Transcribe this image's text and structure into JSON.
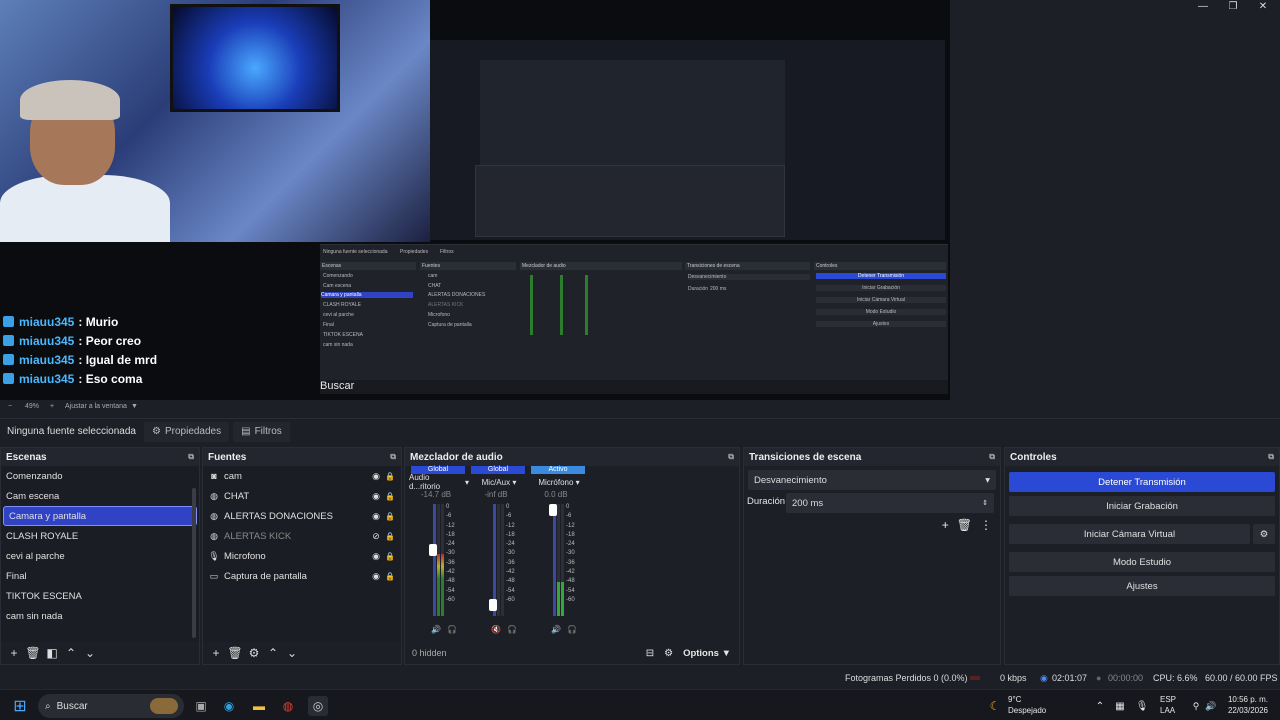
{
  "window": {
    "min": "—",
    "max": "❐",
    "close": "✕"
  },
  "chat": [
    {
      "user": "miauu345",
      "message": ": Murio"
    },
    {
      "user": "miauu345",
      "message": ": Peor creo"
    },
    {
      "user": "miauu345",
      "message": ": Igual de mrd"
    },
    {
      "user": "miauu345",
      "message": ": Eso coma"
    }
  ],
  "zoombar": {
    "minus": "−",
    "zoom": "49%",
    "plus": "+",
    "fit": "Ajustar a la ventana",
    "caret": "▼"
  },
  "context": {
    "no_source": "Ninguna fuente seleccionada",
    "properties": "Propiedades",
    "filters": "Filtros"
  },
  "scenes": {
    "title": "Escenas",
    "items": [
      "Comenzando",
      "Cam escena",
      "Camara y pantalla",
      "CLASH ROYALE",
      "cevi al parche",
      "Final",
      "TIKTOK ESCENA",
      "cam sin nada"
    ],
    "selected_index": 2
  },
  "sources": {
    "title": "Fuentes",
    "items": [
      {
        "name": "cam",
        "icon": "camera-icon"
      },
      {
        "name": "CHAT",
        "icon": "globe-icon"
      },
      {
        "name": "ALERTAS DONACIONES",
        "icon": "globe-icon"
      },
      {
        "name": "ALERTAS KICK",
        "icon": "globe-icon",
        "hidden": true
      },
      {
        "name": "Microfono",
        "icon": "mic-icon"
      },
      {
        "name": "Captura de pantalla",
        "icon": "monitor-icon"
      }
    ]
  },
  "mixer": {
    "title": "Mezclador de audio",
    "channels": [
      {
        "tag": "Global",
        "name": "Audio d...ritorio",
        "db": "-14.7 dB",
        "level": 0.55,
        "fader": 0.6
      },
      {
        "tag": "Global",
        "name": "Mic/Aux",
        "db": "-inf dB",
        "level": 0.0,
        "fader": 0.05,
        "muted": true
      },
      {
        "tag": "Activo",
        "name": "Micrófono",
        "db": "0.0 dB",
        "level": 0.3,
        "fader": 1.0
      }
    ],
    "scale": [
      "0",
      "-6",
      "-12",
      "-18",
      "-24",
      "-30",
      "-36",
      "-42",
      "-48",
      "-54",
      "-60"
    ],
    "hidden_label": "0 hidden",
    "options_label": "Options"
  },
  "transitions": {
    "title": "Transiciones de escena",
    "selected": "Desvanecimiento",
    "duration_label": "Duración",
    "duration_value": "200 ms"
  },
  "controls": {
    "title": "Controles",
    "buttons": [
      "Detener Transmisión",
      "Iniciar Grabación",
      "Iniciar Cámara Virtual",
      "Modo Estudio",
      "Ajustes"
    ]
  },
  "status": {
    "dropped": "Fotogramas Perdidos 0 (0.0%)",
    "kbps": "0 kbps",
    "stream_time": "02:01:07",
    "rec_time": "00:00:00",
    "cpu": "CPU: 6.6%",
    "fps": "60.00 / 60.00 FPS"
  },
  "taskbar": {
    "search": "Buscar",
    "weather_temp": "9°C",
    "weather_desc": "Despejado",
    "lang": "ESP",
    "layout": "LAA",
    "time": "10:56 p. m.",
    "date": "22/03/2026"
  },
  "nested": {
    "no_source": "Ninguna fuente seleccionada",
    "props": "Propiedades",
    "filters": "Filtros",
    "scenes": "Escenas",
    "sources": "Fuentes",
    "mixer": "Mezclador de audio",
    "transitions": "Transiciones de escena",
    "controls": "Controles",
    "scene_items": [
      "Comenzando",
      "Cam escena",
      "Camara y pantalla",
      "CLASH ROYALE",
      "cevi al parche",
      "Final",
      "TIKTOK ESCENA",
      "cam sin nada"
    ],
    "source_items": [
      "cam",
      "CHAT",
      "ALERTAS DONACIONES",
      "ALERTAS KICK",
      "Microfono",
      "Captura de pantalla"
    ],
    "ctl_items": [
      "Detener Transmisión",
      "Iniciar Grabación",
      "Iniciar Cámara Virtual",
      "Modo Estudio",
      "Ajustes"
    ],
    "trans_sel": "Desvanecimiento",
    "duration": "Duración",
    "duration_val": "200 ms",
    "search": "Buscar"
  }
}
